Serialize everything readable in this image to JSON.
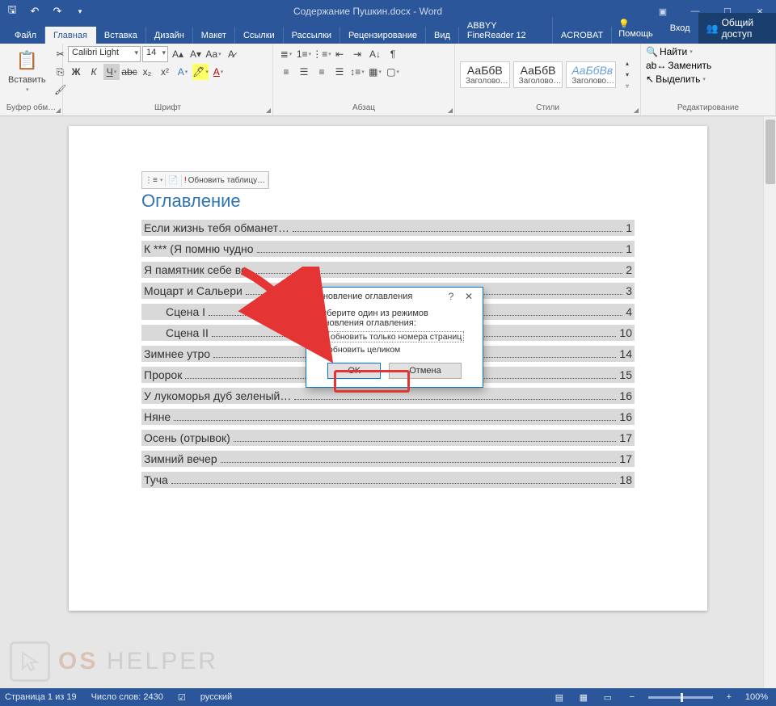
{
  "titlebar": {
    "title": "Содержание Пушкин.docx - Word"
  },
  "tabs": {
    "file": "Файл",
    "home": "Главная",
    "insert": "Вставка",
    "design": "Дизайн",
    "layout": "Макет",
    "references": "Ссылки",
    "mailings": "Рассылки",
    "review": "Рецензирование",
    "view": "Вид",
    "abbyy": "ABBYY FineReader 12",
    "acrobat": "ACROBAT",
    "help": "Помощь",
    "signin": "Вход",
    "share": "Общий доступ"
  },
  "ribbon": {
    "clipboard": {
      "paste": "Вставить",
      "group": "Буфер обм…"
    },
    "font": {
      "name": "Calibri Light",
      "size": "14",
      "group": "Шрифт"
    },
    "paragraph": {
      "group": "Абзац"
    },
    "styles": {
      "group": "Стили",
      "s1": "АаБбВ",
      "s1_label": "Заголово…",
      "s2": "АаБбВ",
      "s2_label": "Заголово…",
      "s3": "АаБбВв",
      "s3_label": "Заголово…"
    },
    "editing": {
      "group": "Редактирование",
      "find": "Найти",
      "replace": "Заменить",
      "select": "Выделить"
    }
  },
  "toc": {
    "toolbar_update": "Обновить таблицу…",
    "title": "Оглавление",
    "entries": [
      {
        "text": "Если жизнь тебя обманет…",
        "page": "1",
        "indent": 0
      },
      {
        "text": "К *** (Я помню чудно",
        "page": "1",
        "indent": 0
      },
      {
        "text": "Я памятник себе во",
        "page": "2",
        "indent": 0
      },
      {
        "text": "Моцарт и Сальери",
        "page": "3",
        "indent": 0
      },
      {
        "text": "Сцена I",
        "page": "4",
        "indent": 1
      },
      {
        "text": "Сцена II",
        "page": "10",
        "indent": 1
      },
      {
        "text": "Зимнее утро",
        "page": "14",
        "indent": 0
      },
      {
        "text": "Пророк",
        "page": "15",
        "indent": 0
      },
      {
        "text": "У лукоморья дуб зеленый…",
        "page": "16",
        "indent": 0
      },
      {
        "text": "Няне",
        "page": "16",
        "indent": 0
      },
      {
        "text": "Осень (отрывок)",
        "page": "17",
        "indent": 0
      },
      {
        "text": "Зимний вечер",
        "page": "17",
        "indent": 0
      },
      {
        "text": "Туча",
        "page": "18",
        "indent": 0
      }
    ]
  },
  "dialog": {
    "title": "Обновление оглавления",
    "instruction": "Выберите один из режимов обновления оглавления:",
    "opt1": "обновить только номера страниц",
    "opt2": "обновить целиком",
    "ok": "OK",
    "cancel": "Отмена"
  },
  "status": {
    "page": "Страница 1 из 19",
    "words": "Число слов: 2430",
    "lang": "русский",
    "zoom": "100%"
  },
  "watermark": {
    "os": "OS",
    "helper": "HELPER"
  }
}
